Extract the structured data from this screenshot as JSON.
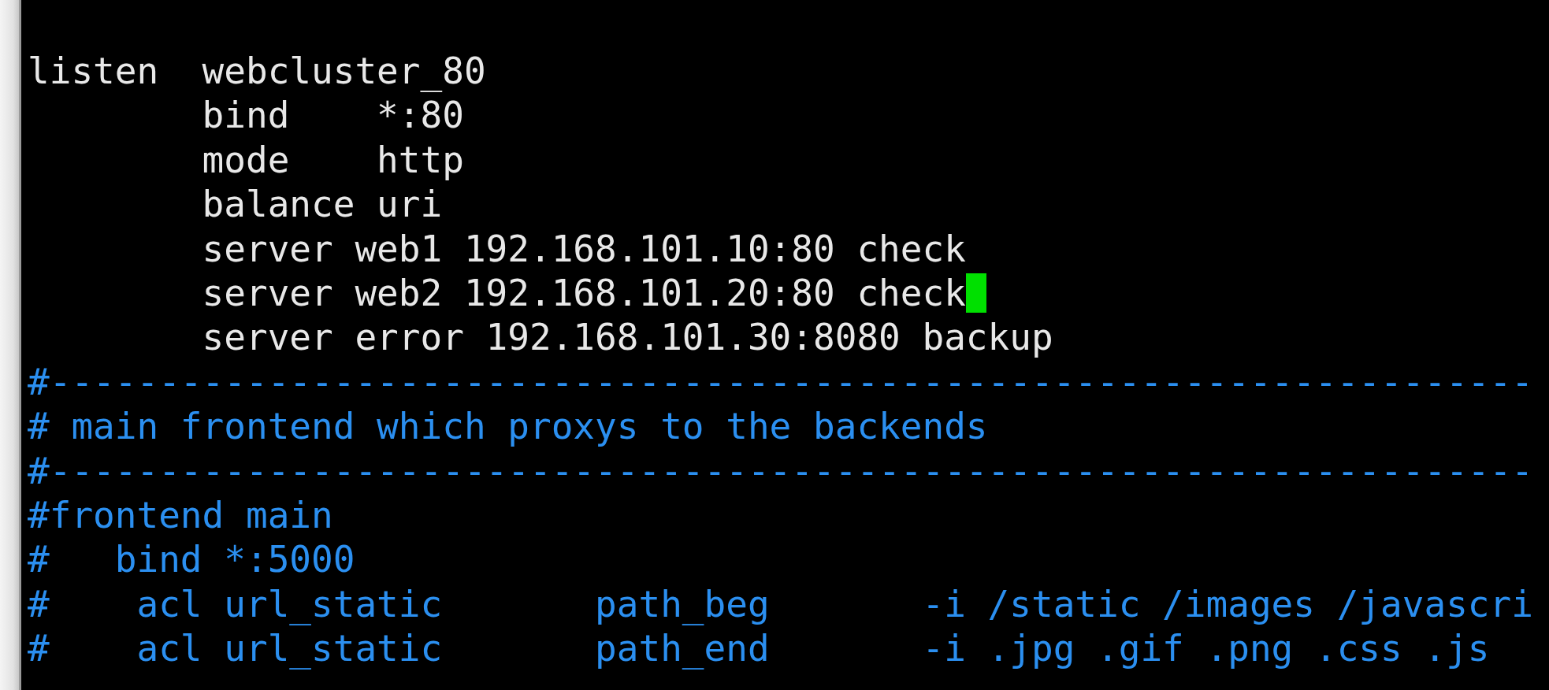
{
  "terminal": {
    "lines": [
      {
        "kind": "code",
        "text": "listen  webcluster_80",
        "cursor": false
      },
      {
        "kind": "code",
        "text": "        bind    *:80",
        "cursor": false
      },
      {
        "kind": "code",
        "text": "        mode    http",
        "cursor": false
      },
      {
        "kind": "code",
        "text": "        balance uri",
        "cursor": false
      },
      {
        "kind": "code",
        "text": "        server web1 192.168.101.10:80 check",
        "cursor": false
      },
      {
        "kind": "code",
        "text": "        server web2 192.168.101.20:80 check",
        "cursor": true
      },
      {
        "kind": "code",
        "text": "        server error 192.168.101.30:8080 backup",
        "cursor": false
      },
      {
        "kind": "comment",
        "text": "#--------------------------------------------------------------------",
        "cursor": false
      },
      {
        "kind": "comment",
        "text": "# main frontend which proxys to the backends",
        "cursor": false
      },
      {
        "kind": "comment",
        "text": "#--------------------------------------------------------------------",
        "cursor": false
      },
      {
        "kind": "comment",
        "text": "#frontend main",
        "cursor": false
      },
      {
        "kind": "comment",
        "text": "#   bind *:5000",
        "cursor": false
      },
      {
        "kind": "comment",
        "text": "#    acl url_static       path_beg       -i /static /images /javascri",
        "cursor": false
      },
      {
        "kind": "comment",
        "text": "#    acl url_static       path_end       -i .jpg .gif .png .css .js",
        "cursor": false
      }
    ]
  }
}
